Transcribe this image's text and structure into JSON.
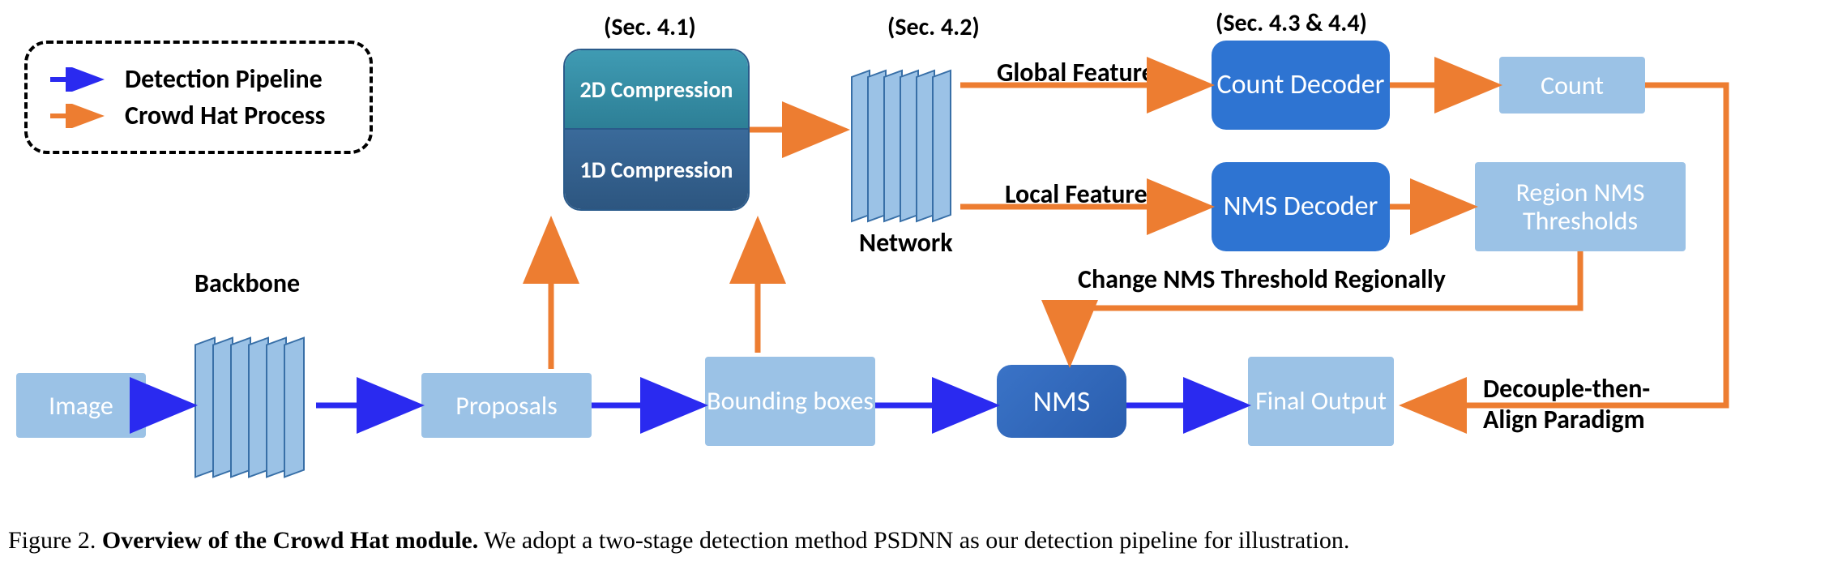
{
  "legend": {
    "detection": "Detection Pipeline",
    "crowdhat": "Crowd Hat Process"
  },
  "sections": {
    "s41": "(Sec. 4.1)",
    "s42": "(Sec. 4.2)",
    "s43": "(Sec. 4.3 & 4.4)"
  },
  "labels": {
    "backbone": "Backbone",
    "network": "Network",
    "global_feature": "Global Feature",
    "local_feature": "Local Feature",
    "change_nms": "Change NMS Threshold Regionally",
    "decouple": "Decouple-then-",
    "align": "Align Paradigm"
  },
  "nodes": {
    "image": "Image",
    "proposals": "Proposals",
    "bounding": "Bounding boxes",
    "nms": "NMS",
    "final": "Final Output",
    "comp2d": "2D Compression",
    "comp1d": "1D Compression",
    "count_decoder": "Count Decoder",
    "nms_decoder": "NMS Decoder",
    "count": "Count",
    "region_nms": "Region NMS Thresholds"
  },
  "caption": {
    "prefix": "Figure 2. ",
    "bold": "Overview of the Crowd Hat module.",
    "rest": " We adopt a two-stage detection method PSDNN as our detection pipeline for illustration."
  },
  "colors": {
    "blue_arrow": "#2a2af0",
    "orange_arrow": "#ed7d31"
  }
}
